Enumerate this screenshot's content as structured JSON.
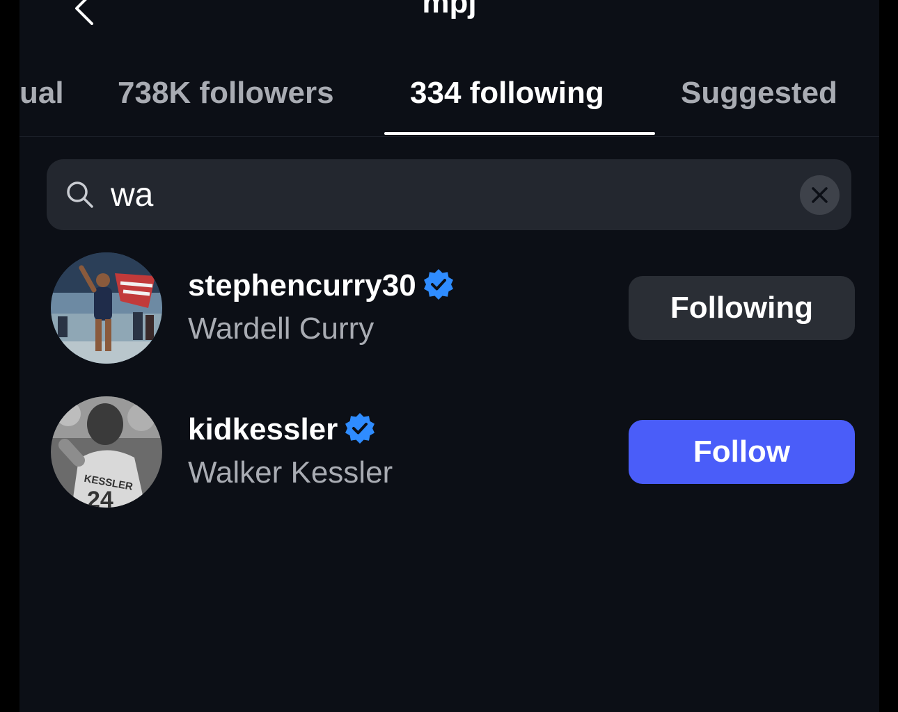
{
  "header": {
    "title": "mpj",
    "back_icon": "chevron-left-icon"
  },
  "tabs": [
    {
      "label": "ual",
      "active": false
    },
    {
      "label": "738K followers",
      "active": false
    },
    {
      "label": "334 following",
      "active": true
    },
    {
      "label": "Suggested",
      "active": false
    }
  ],
  "search": {
    "value": "wa",
    "icon": "search-icon",
    "clear_icon": "close-icon"
  },
  "results": [
    {
      "username": "stephencurry30",
      "full_name": "Wardell Curry",
      "verified": true,
      "button_label": "Following"
    },
    {
      "username": "kidkessler",
      "full_name": "Walker Kessler",
      "verified": true,
      "button_label": "Follow"
    }
  ],
  "colors": {
    "background": "#0c0f16",
    "search_bg": "#23272f",
    "following_btn": "#2a2e35",
    "follow_btn": "#4a5df9",
    "verified": "#2f8cff",
    "secondary_text": "#a9acb3"
  }
}
